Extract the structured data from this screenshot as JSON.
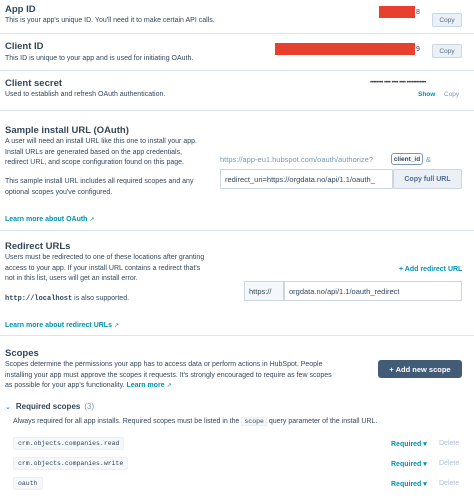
{
  "app_id": {
    "title": "App ID",
    "description": "This is your app's unique ID. You'll need it to make certain API calls.",
    "value_suffix": "8",
    "copy_label": "Copy"
  },
  "client_id": {
    "title": "Client ID",
    "description": "This ID is unique to your app and is used for initiating OAuth.",
    "value_suffix": "9",
    "copy_label": "Copy"
  },
  "client_secret": {
    "title": "Client secret",
    "description": "Used to establish and refresh OAuth authentication.",
    "masked_value": "•••••••• •••• •••• •••• ••••••••••••",
    "show_label": "Show",
    "copy_label": "Copy"
  },
  "sample_install_url": {
    "title": "Sample install URL (OAuth)",
    "description_1": "A user will need an install URL like this one to install your app. Install URLs are generated based on the app credentials, redirect URL, and scope configuration found on this page.",
    "description_2": "This sample install URL includes all required scopes and any optional scopes you've configured.",
    "learn_more": "Learn more about OAuth",
    "url_prefix": "https://app-eu1.hubspot.com/oauth/authorize?",
    "chip_label": "client_id",
    "url_amp": "&",
    "url_value": "redirect_uri=https://orgdata.no/api/1.1/oauth_",
    "copy_full_label": "Copy full URL"
  },
  "redirect_urls": {
    "title": "Redirect URLs",
    "description": "Users must be redirected to one of these locations after granting access to your app. If your install URL contains a redirect that's not in this list, users will get an install error.",
    "localhost_code": "http://localhost",
    "localhost_text": "is also supported.",
    "learn_more": "Learn more about redirect URLs",
    "add_label": "+ Add redirect URL",
    "protocol": "https://",
    "path": "orgdata.no/api/1.1/oauth_redirect"
  },
  "scopes": {
    "title": "Scopes",
    "description": "Scopes determine the permissions your app has to access data or perform actions in HubSpot. People installing your app must approve the scopes it requests. It's strongly encouraged to require as few scopes as possible for your app's functionality.",
    "learn_more": "Learn more",
    "add_button": "+ Add new scope",
    "required_header": "Required scopes",
    "required_count": "(3)",
    "required_note_pre": "Always required for all app installs. Required scopes must be listed in the",
    "required_note_code": "scope",
    "required_note_post": "query parameter of the install URL.",
    "items": [
      {
        "name": "crm.objects.companies.read",
        "status": "Required ▾",
        "delete": "Delete"
      },
      {
        "name": "crm.objects.companies.write",
        "status": "Required ▾",
        "delete": "Delete"
      },
      {
        "name": "oauth",
        "status": "Required ▾",
        "delete": "Delete"
      }
    ]
  }
}
